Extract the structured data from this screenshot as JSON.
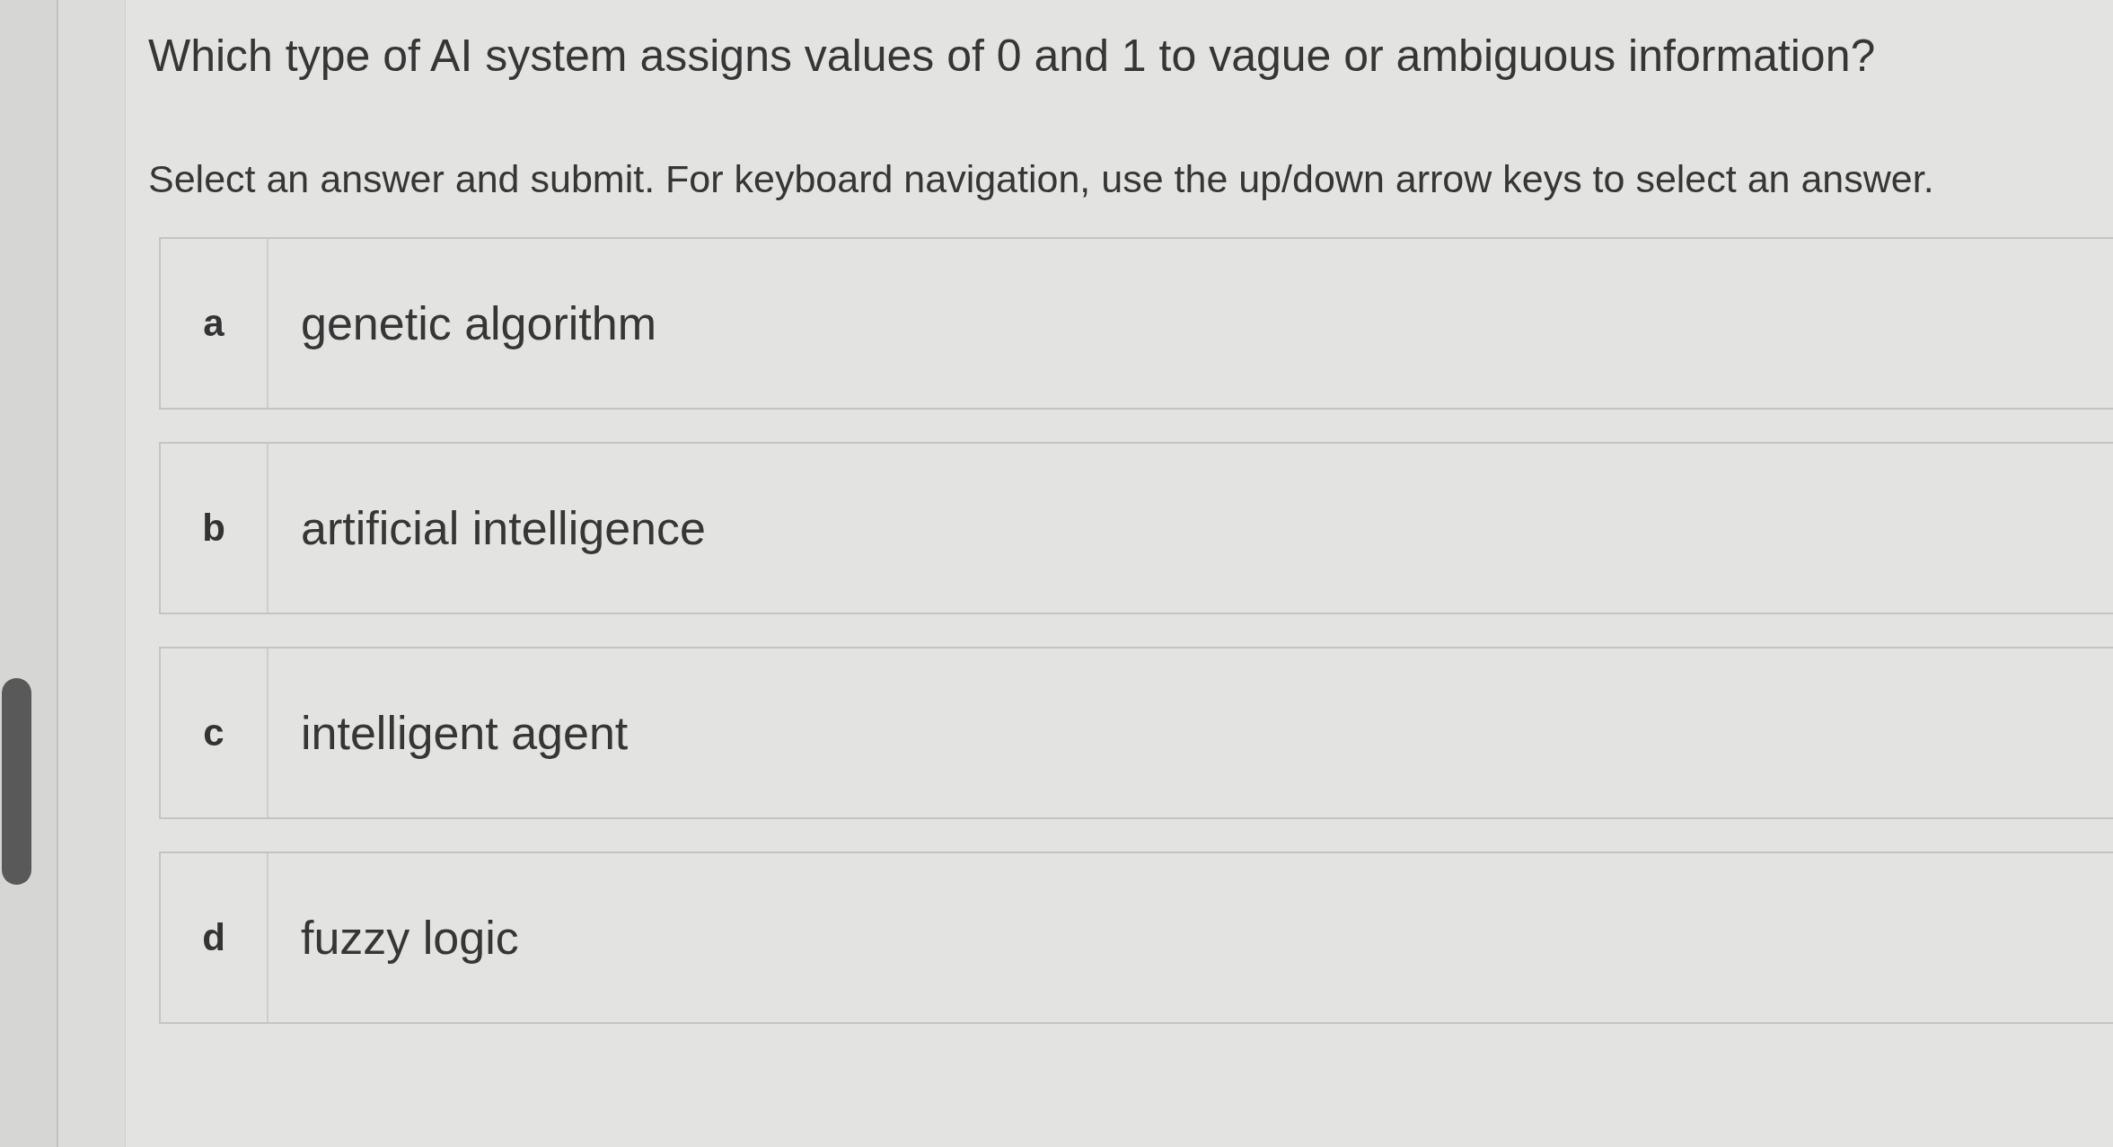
{
  "question": "Which type of AI system assigns values of 0 and 1 to vague or ambiguous information?",
  "instructions": "Select an answer and submit. For keyboard navigation, use the up/down arrow keys to select an answer.",
  "options": [
    {
      "letter": "a",
      "text": "genetic algorithm",
      "selected": false
    },
    {
      "letter": "b",
      "text": "artificial intelligence",
      "selected": false
    },
    {
      "letter": "c",
      "text": "intelligent agent",
      "selected": false
    },
    {
      "letter": "d",
      "text": "fuzzy logic",
      "selected": false
    }
  ]
}
